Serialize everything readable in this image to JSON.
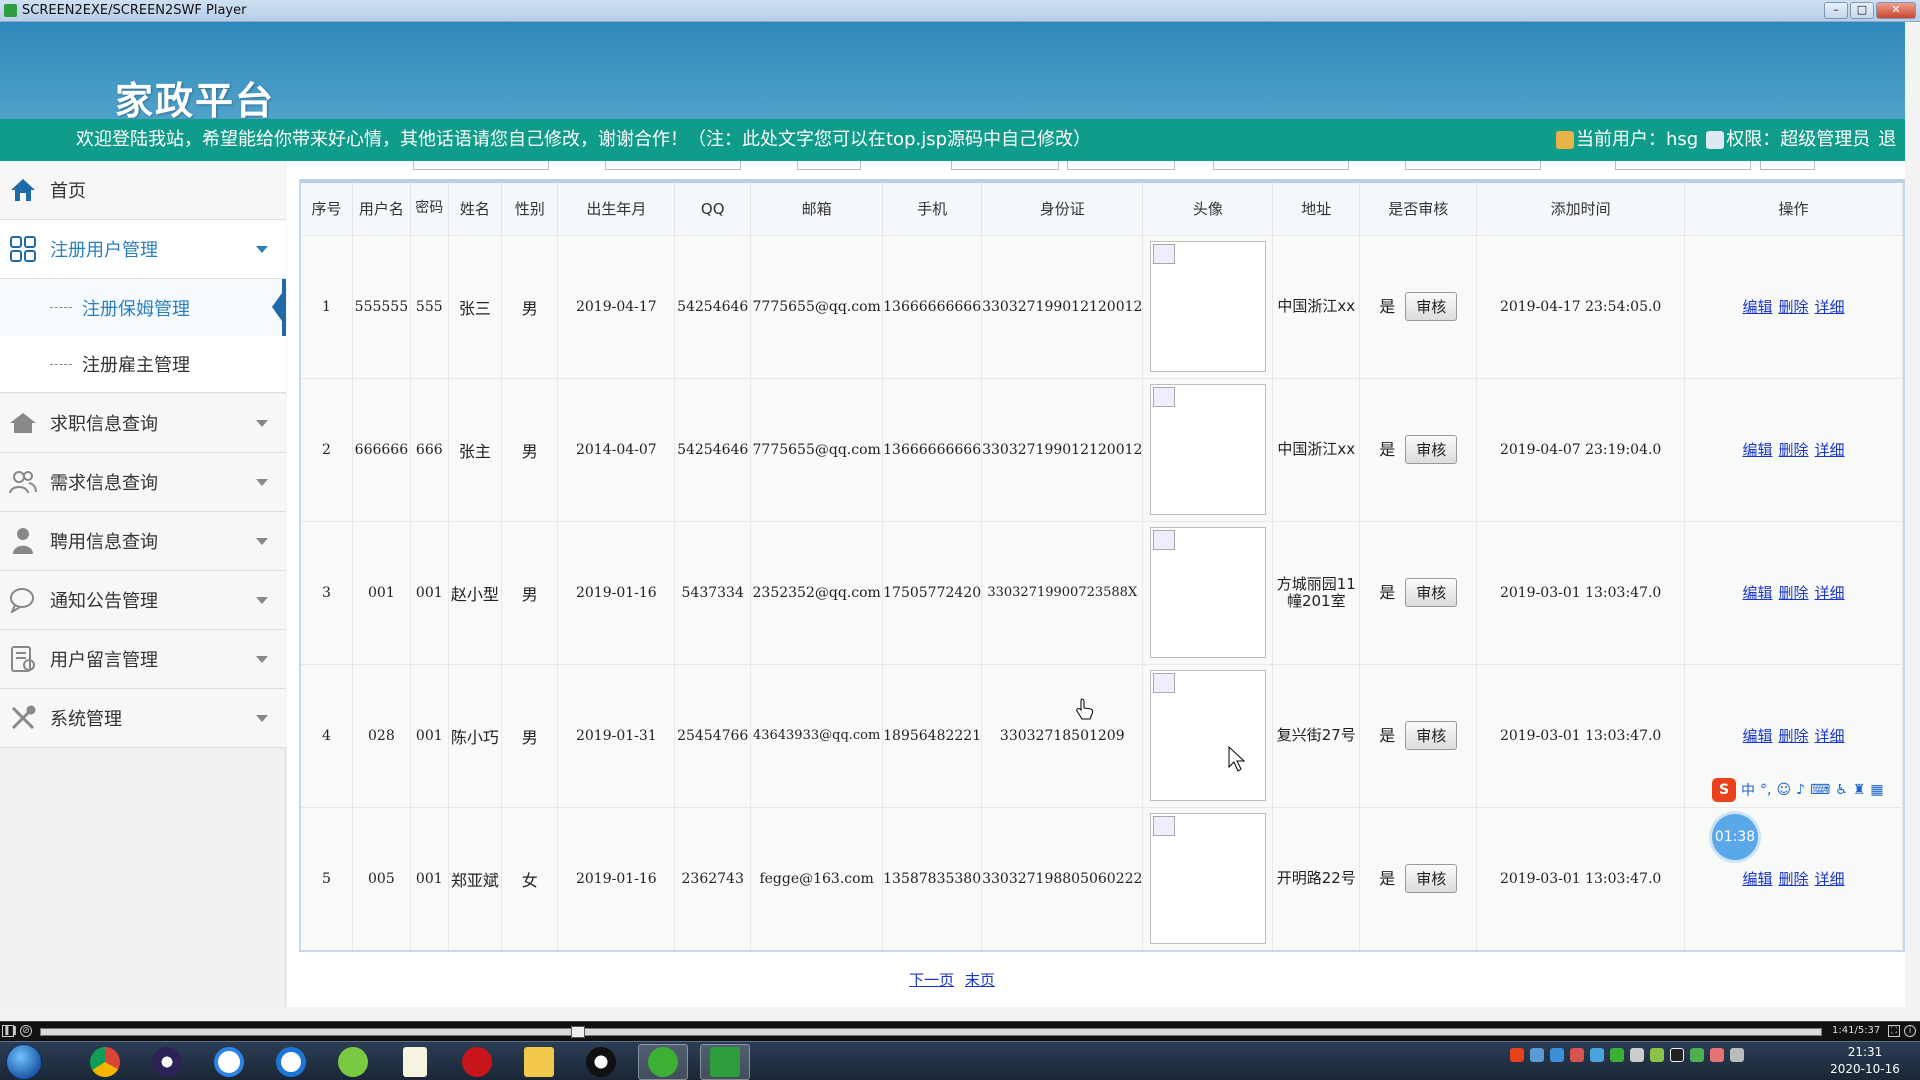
{
  "window": {
    "title": "SCREEN2EXE/SCREEN2SWF Player",
    "min_icon": "minimize-icon",
    "max_icon": "maximize-icon",
    "close_icon": "close-icon"
  },
  "header": {
    "logo_text": "家政平台",
    "welcome_message": "欢迎登陆我站，希望能给你带来好心情，其他话语请您自己修改，谢谢合作！（注：此处文字您可以在top.jsp源码中自己修改）",
    "current_user": "当前用户：hsg",
    "role": "权限：超级管理员",
    "logout_fragment": "退"
  },
  "sidebar": {
    "home": "首页",
    "groups": [
      {
        "label": "注册用户管理",
        "icon": "grid-icon"
      },
      {
        "label": "求职信息查询",
        "icon": "house-icon"
      },
      {
        "label": "需求信息查询",
        "icon": "users-icon"
      },
      {
        "label": "聘用信息查询",
        "icon": "person-icon"
      },
      {
        "label": "通知公告管理",
        "icon": "chat-icon"
      },
      {
        "label": "用户留言管理",
        "icon": "note-icon"
      },
      {
        "label": "系统管理",
        "icon": "tools-icon"
      }
    ],
    "subitems": [
      "注册保姆管理",
      "注册雇主管理"
    ]
  },
  "table": {
    "headers": [
      "序号",
      "用户名",
      "密码",
      "姓名",
      "性别",
      "出生年月",
      "QQ",
      "邮箱",
      "手机",
      "身份证",
      "头像",
      "地址",
      "是否审核",
      "添加时间",
      "操作"
    ],
    "rows": [
      {
        "no": "1",
        "username": "555555",
        "password": "555",
        "name": "张三",
        "gender": "男",
        "birth": "2019-04-17",
        "qq": "54254646",
        "email": "7775655@qq.com",
        "phone": "13666666666",
        "idcard": "330327199012120012",
        "address": "中国浙江xx",
        "approved": "是",
        "added": "2019-04-17 23:54:05.0"
      },
      {
        "no": "2",
        "username": "666666",
        "password": "666",
        "name": "张主",
        "gender": "男",
        "birth": "2014-04-07",
        "qq": "54254646",
        "email": "7775655@qq.com",
        "phone": "13666666666",
        "idcard": "330327199012120012",
        "address": "中国浙江xx",
        "approved": "是",
        "added": "2019-04-07 23:19:04.0"
      },
      {
        "no": "3",
        "username": "001",
        "password": "001",
        "name": "赵小型",
        "gender": "男",
        "birth": "2019-01-16",
        "qq": "5437334",
        "email": "2352352@qq.com",
        "phone": "17505772420",
        "idcard": "33032719900723588X",
        "address": "方城丽园11幢201室",
        "approved": "是",
        "added": "2019-03-01 13:03:47.0"
      },
      {
        "no": "4",
        "username": "028",
        "password": "001",
        "name": "陈小巧",
        "gender": "男",
        "birth": "2019-01-31",
        "qq": "25454766",
        "email": "43643933@qq.com",
        "phone": "18956482221",
        "idcard": "33032718501209",
        "address": "复兴街27号",
        "approved": "是",
        "added": "2019-03-01 13:03:47.0"
      },
      {
        "no": "5",
        "username": "005",
        "password": "001",
        "name": "郑亚斌",
        "gender": "女",
        "birth": "2019-01-16",
        "qq": "2362743",
        "email": "fegge@163.com",
        "phone": "13587835380",
        "idcard": "330327198805060222",
        "address": "开明路22号",
        "approved": "是",
        "added": "2019-03-01 13:03:47.0"
      }
    ],
    "audit_button": "审核",
    "actions": [
      "编辑",
      "删除",
      "详细"
    ]
  },
  "pager": {
    "next": "下一页",
    "last": "末页"
  },
  "ime": {
    "mode": "中",
    "punct": "°,"
  },
  "recorder_timer": "01:38",
  "player": {
    "time": "1:41/5:37"
  },
  "taskbar": {
    "clock_time": "21:31",
    "clock_date": "2020-10-16"
  },
  "colors": {
    "banner": "#3e96c4",
    "welcome_bar": "#109c8a",
    "link": "#1a35c9"
  }
}
